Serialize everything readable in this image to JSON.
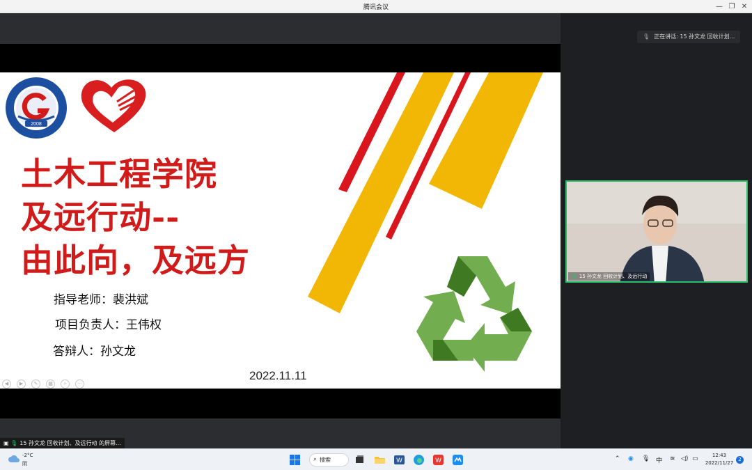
{
  "window": {
    "title": "腾讯会议"
  },
  "slide": {
    "title_lines": [
      "土木工程学院",
      "及远行动--",
      "由此向，及远方"
    ],
    "advisor": "指导老师：裴洪斌",
    "leader": "项目负责人：王伟权",
    "defender": "答辩人：孙文龙",
    "date": "2022.11.11",
    "colors": {
      "title": "#d11b1b",
      "stripe_red": "#d9161e",
      "stripe_yellow": "#f2b705",
      "recycle_light": "#72ad4f",
      "recycle_dark": "#3f7a23"
    },
    "logo_text": "2008"
  },
  "meeting": {
    "speaking": "正在讲话: 15 孙文龙 回收计划...",
    "participant_label": "15 孙文龙 回收计划、及远行动",
    "share_status": "15 孙文龙 回收计划、及远行动 的屏幕..."
  },
  "taskbar": {
    "temperature": "-2°C",
    "condition": "阴",
    "search_label": "搜索",
    "ime": "中",
    "time": "12:43",
    "date": "2022/11/27",
    "notifications": "2"
  }
}
